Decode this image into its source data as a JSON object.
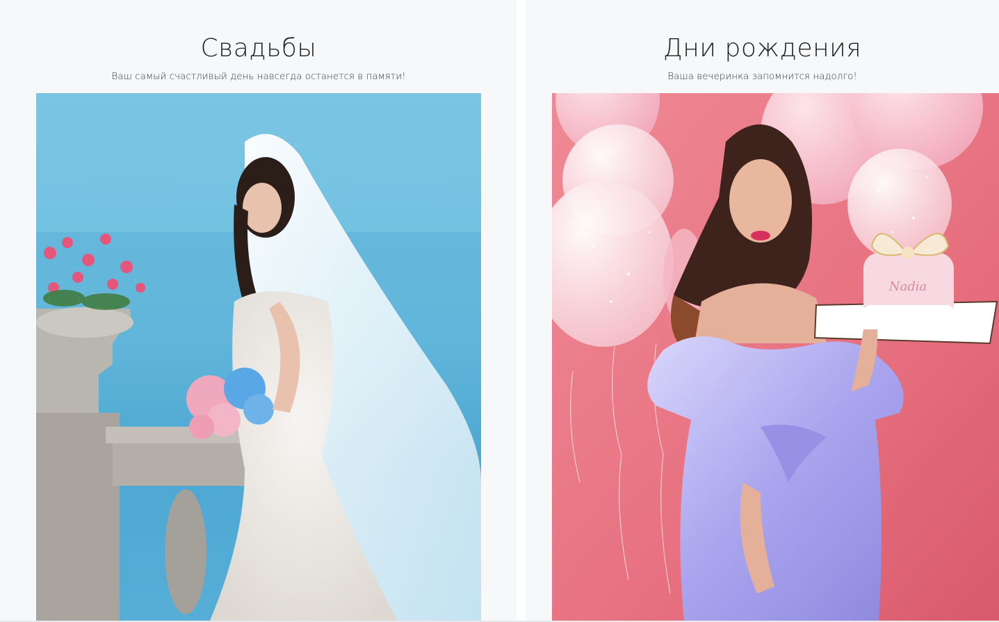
{
  "cards": [
    {
      "title": "Свадьбы",
      "subtitle": "Ваш самый счастливый день навсегда останется в памяти!",
      "image_alt": "bride-photo"
    },
    {
      "title": "Дни рождения",
      "subtitle": "Ваша вечеринка запомнится надолго!",
      "image_alt": "birthday-photo",
      "cake_text": "Nadia"
    }
  ],
  "colors": {
    "card_background": "#f7f8fa",
    "title_text": "#222222",
    "wedding_sky": "#7cc6e4",
    "birthday_background": "#e8707e",
    "dress_lavender": "#b7b4ef"
  }
}
